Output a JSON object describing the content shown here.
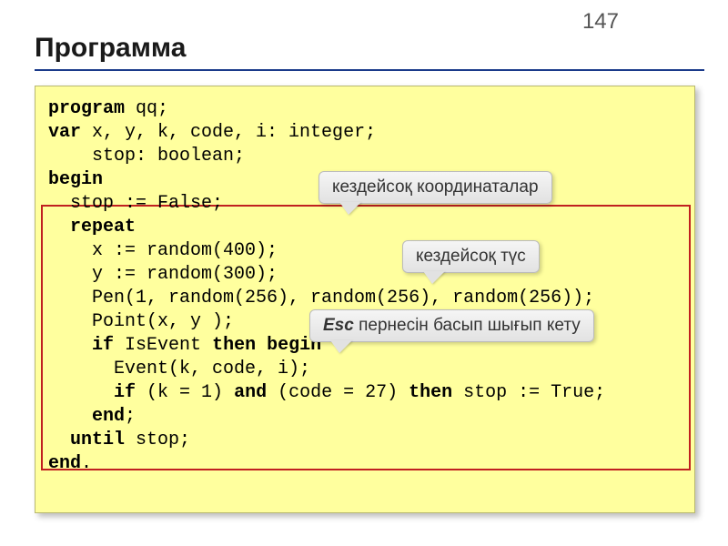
{
  "page_number": "147",
  "title": "Программа",
  "code": {
    "l1a": "program",
    "l1b": " qq;",
    "l2a": "var",
    "l2b": " x, y, k, code, i: integer;",
    "l3": "    stop: boolean;",
    "l4": "begin",
    "l5": "  stop := False;",
    "l6": "  repeat",
    "l7": "    x := random(400);",
    "l8": "    y := random(300);",
    "l9": "    Pen(1, random(256), random(256), random(256));",
    "l10": "    Point(x, y );",
    "l11a": "    ",
    "l11b": "if",
    "l11c": " IsEvent ",
    "l11d": "then begin",
    "l12": "      Event(k, code, i);",
    "l13a": "      ",
    "l13b": "if",
    "l13c": " (k = 1) ",
    "l13d": "and",
    "l13e": " (code = 27) ",
    "l13f": "then",
    "l13g": " stop := True;",
    "l14a": "    ",
    "l14b": "end",
    "l14c": ";",
    "l15a": "  ",
    "l15b": "until",
    "l15c": " stop;",
    "l16a": "end",
    "l16b": "."
  },
  "callouts": {
    "c1": "кездейсоқ координаталар",
    "c2": "кездейсоқ түс",
    "c3_bold": "Esc",
    "c3_rest": " пернесін басып шығып кету"
  }
}
